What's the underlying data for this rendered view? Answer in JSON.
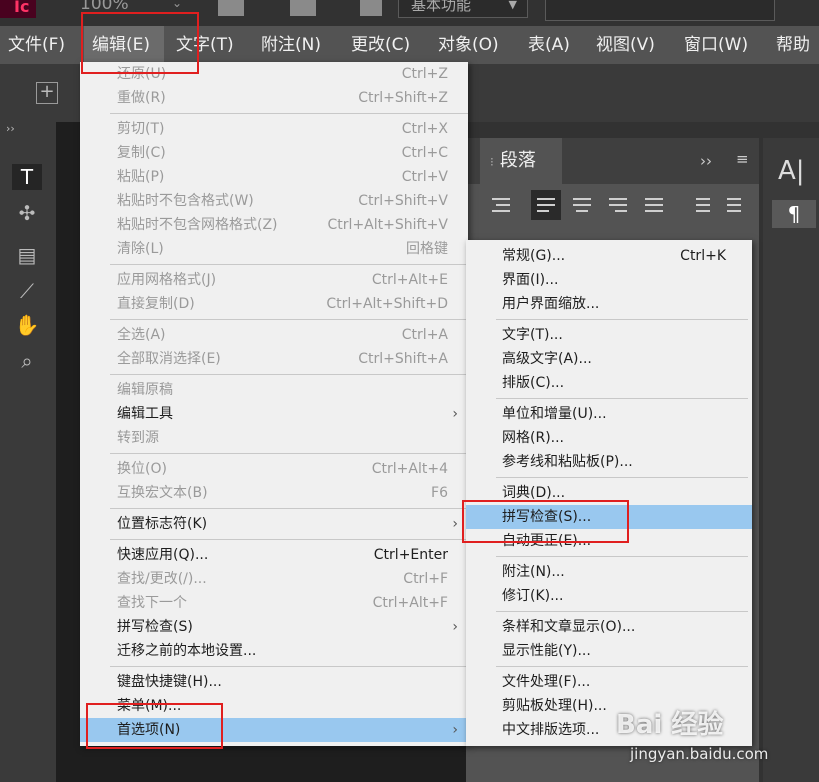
{
  "app": {
    "logo": "Ic",
    "zoom": "100%",
    "workspace": "基本功能"
  },
  "menubar": [
    {
      "label": "文件(F)"
    },
    {
      "label": "编辑(E)"
    },
    {
      "label": "文字(T)"
    },
    {
      "label": "附注(N)"
    },
    {
      "label": "更改(C)"
    },
    {
      "label": "对象(O)"
    },
    {
      "label": "表(A)"
    },
    {
      "label": "视图(V)"
    },
    {
      "label": "窗口(W)"
    },
    {
      "label": "帮助"
    }
  ],
  "paragraph_panel": {
    "tab": "段落"
  },
  "edit_menu": [
    {
      "label": "还原(U)",
      "shortcut": "Ctrl+Z",
      "enabled": false
    },
    {
      "label": "重做(R)",
      "shortcut": "Ctrl+Shift+Z",
      "enabled": false
    },
    {
      "label": "剪切(T)",
      "shortcut": "Ctrl+X",
      "enabled": false
    },
    {
      "label": "复制(C)",
      "shortcut": "Ctrl+C",
      "enabled": false
    },
    {
      "label": "粘贴(P)",
      "shortcut": "Ctrl+V",
      "enabled": false
    },
    {
      "label": "粘贴时不包含格式(W)",
      "shortcut": "Ctrl+Shift+V",
      "enabled": false
    },
    {
      "label": "粘贴时不包含网格格式(Z)",
      "shortcut": "Ctrl+Alt+Shift+V",
      "enabled": false
    },
    {
      "label": "清除(L)",
      "shortcut": "回格键",
      "enabled": false
    },
    {
      "label": "应用网格格式(J)",
      "shortcut": "Ctrl+Alt+E",
      "enabled": false
    },
    {
      "label": "直接复制(D)",
      "shortcut": "Ctrl+Alt+Shift+D",
      "enabled": false
    },
    {
      "label": "全选(A)",
      "shortcut": "Ctrl+A",
      "enabled": false
    },
    {
      "label": "全部取消选择(E)",
      "shortcut": "Ctrl+Shift+A",
      "enabled": false
    },
    {
      "label": "编辑原稿",
      "shortcut": "",
      "enabled": false
    },
    {
      "label": "编辑工具",
      "shortcut": "",
      "enabled": true,
      "submenu": true
    },
    {
      "label": "转到源",
      "shortcut": "",
      "enabled": false
    },
    {
      "label": "换位(O)",
      "shortcut": "Ctrl+Alt+4",
      "enabled": false
    },
    {
      "label": "互换宏文本(B)",
      "shortcut": "F6",
      "enabled": false
    },
    {
      "label": "位置标志符(K)",
      "shortcut": "",
      "enabled": true,
      "submenu": true
    },
    {
      "label": "快速应用(Q)...",
      "shortcut": "Ctrl+Enter",
      "enabled": true
    },
    {
      "label": "查找/更改(/)...",
      "shortcut": "Ctrl+F",
      "enabled": false
    },
    {
      "label": "查找下一个",
      "shortcut": "Ctrl+Alt+F",
      "enabled": false
    },
    {
      "label": "拼写检查(S)",
      "shortcut": "",
      "enabled": true,
      "submenu": true
    },
    {
      "label": "迁移之前的本地设置...",
      "shortcut": "",
      "enabled": true
    },
    {
      "label": "键盘快捷键(H)...",
      "shortcut": "",
      "enabled": true
    },
    {
      "label": "菜单(M)...",
      "shortcut": "",
      "enabled": true
    },
    {
      "label": "首选项(N)",
      "shortcut": "",
      "enabled": true,
      "submenu": true,
      "highlighted": true
    }
  ],
  "prefs_menu": [
    {
      "label": "常规(G)...",
      "shortcut": "Ctrl+K"
    },
    {
      "label": "界面(I)...",
      "shortcut": ""
    },
    {
      "label": "用户界面缩放...",
      "shortcut": ""
    },
    {
      "label": "文字(T)...",
      "shortcut": ""
    },
    {
      "label": "高级文字(A)...",
      "shortcut": ""
    },
    {
      "label": "排版(C)...",
      "shortcut": ""
    },
    {
      "label": "单位和增量(U)...",
      "shortcut": ""
    },
    {
      "label": "网格(R)...",
      "shortcut": ""
    },
    {
      "label": "参考线和粘贴板(P)...",
      "shortcut": ""
    },
    {
      "label": "词典(D)...",
      "shortcut": ""
    },
    {
      "label": "拼写检查(S)...",
      "shortcut": "",
      "highlighted": true
    },
    {
      "label": "自动更正(E)...",
      "shortcut": ""
    },
    {
      "label": "附注(N)...",
      "shortcut": ""
    },
    {
      "label": "修订(K)...",
      "shortcut": ""
    },
    {
      "label": "条样和文章显示(O)...",
      "shortcut": ""
    },
    {
      "label": "显示性能(Y)...",
      "shortcut": ""
    },
    {
      "label": "文件处理(F)...",
      "shortcut": ""
    },
    {
      "label": "剪贴板处理(H)...",
      "shortcut": ""
    },
    {
      "label": "中文排版选项...",
      "shortcut": ""
    }
  ],
  "watermark": {
    "brand": "Bai 经验",
    "url": "jingyan.baidu.com"
  },
  "colors": {
    "menu_bg": "#f0f0f0",
    "highlight": "#99c8ef",
    "annotation": "#e01f1f",
    "app_bg": "#323232"
  }
}
